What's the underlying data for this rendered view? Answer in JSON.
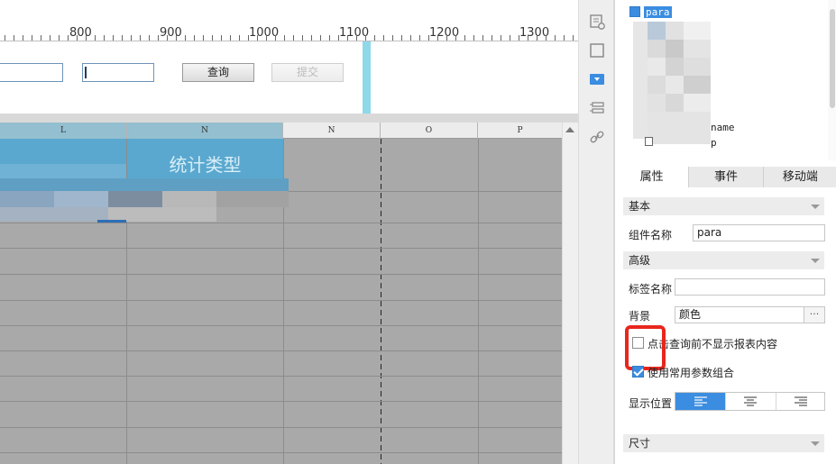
{
  "ruler": {
    "labels": [
      "800",
      "900",
      "1000",
      "1100",
      "1200",
      "1300"
    ]
  },
  "param_bar": {
    "query_label": "查询",
    "submit_label": "提交"
  },
  "grid": {
    "columns": [
      "L",
      "N",
      "N",
      "O",
      "P"
    ],
    "header_cell": "统计类型"
  },
  "tree": {
    "root_label": "para",
    "item_name_suffix": "name",
    "item_p_suffix": "p"
  },
  "panel": {
    "tabs": [
      "属性",
      "事件",
      "移动端"
    ],
    "sections": {
      "basic": "基本",
      "advanced": "高级",
      "size": "尺寸"
    },
    "widget_name_label": "组件名称",
    "widget_name_value": "para",
    "tag_name_label": "标签名称",
    "tag_name_value": "",
    "background_label": "背景",
    "background_value": "颜色",
    "dots": "···",
    "hide_before_query_label": "点击查询前不显示报表内容",
    "hide_before_query_checked": false,
    "use_common_params_label": "使用常用参数组合",
    "use_common_params_checked": true,
    "display_position_label": "显示位置"
  },
  "colors": {
    "accent": "#3a8de0",
    "header_cell": "#5aa8cf",
    "highlight": "#e8261d",
    "strip": "#8ed8ea"
  }
}
